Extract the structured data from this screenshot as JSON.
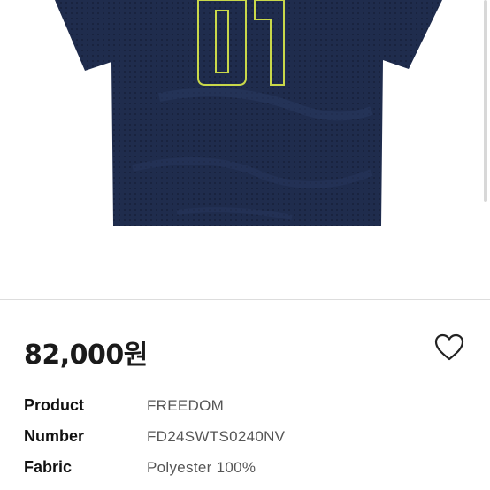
{
  "product": {
    "image_icon": "navy-mesh-jersey-01",
    "jersey_number": "01",
    "jersey_color": "#1d2a4a",
    "number_outline_color": "#c9d84a"
  },
  "price": {
    "amount": "82,000원"
  },
  "like_icon": "heart-outline-icon",
  "specs": [
    {
      "label": "Product",
      "value": "FREEDOM"
    },
    {
      "label": "Number",
      "value": "FD24SWTS0240NV"
    },
    {
      "label": "Fabric",
      "value": "Polyester 100%"
    }
  ]
}
